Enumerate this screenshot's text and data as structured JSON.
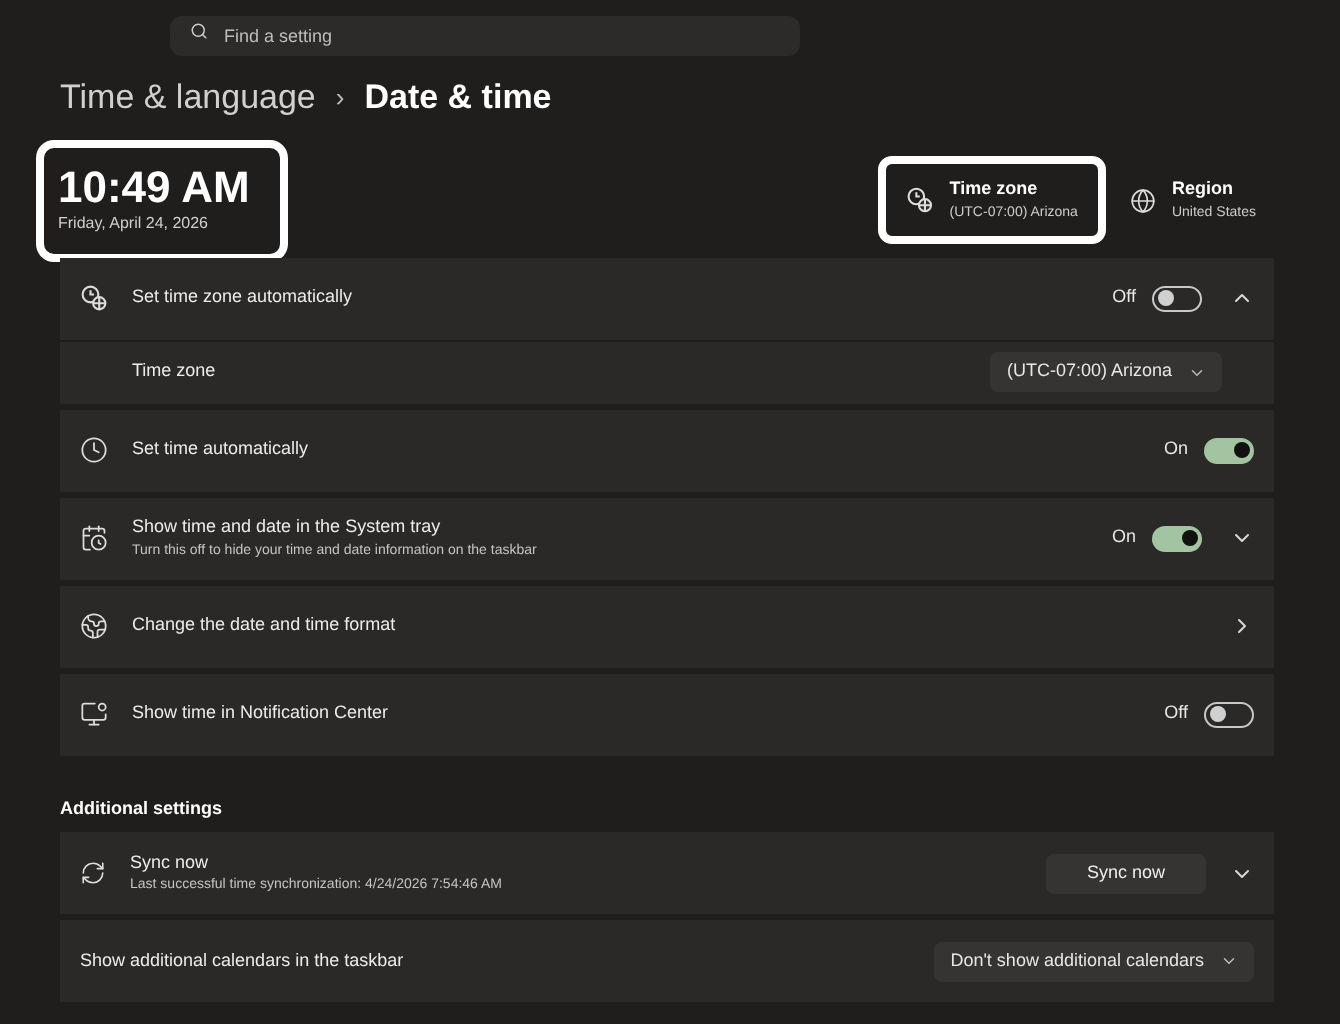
{
  "search": {
    "placeholder": "Find a setting"
  },
  "breadcrumb": {
    "parent": "Time & language",
    "separator": "›",
    "current": "Date & time"
  },
  "clock": {
    "time": "10:49 AM",
    "date": "Friday, April 24, 2026"
  },
  "summary": [
    {
      "title": "Time zone",
      "value": "(UTC-07:00) Arizona",
      "highlighted": true
    },
    {
      "title": "Region",
      "value": "United States",
      "highlighted": false
    }
  ],
  "rows": [
    {
      "kind": "toggle",
      "title": "Set time zone automatically",
      "state_text": "Off",
      "on": false,
      "expanded": true,
      "children": [
        {
          "kind": "dropdown",
          "title": "Time zone",
          "value": "(UTC-07:00) Arizona"
        }
      ]
    },
    {
      "kind": "toggle",
      "title": "Set time automatically",
      "state_text": "On",
      "on": true
    },
    {
      "kind": "toggle",
      "title": "Show time and date in the System tray",
      "subtitle": "Turn this off to hide your time and date information on the taskbar",
      "state_text": "On",
      "on": true,
      "expanded": false
    },
    {
      "kind": "link",
      "title": "Change the date and time format"
    },
    {
      "kind": "toggle",
      "title": "Show time in Notification Center",
      "state_text": "Off",
      "on": false
    }
  ],
  "additional": {
    "heading": "Additional settings",
    "rows": [
      {
        "kind": "button",
        "title": "Sync now",
        "subtitle": "Last successful time synchronization: 4/24/2026 7:54:46 AM",
        "button": "Sync now",
        "expanded": false
      },
      {
        "kind": "dropdown",
        "title": "Show additional calendars in the taskbar",
        "value": "Don't show additional calendars"
      }
    ]
  }
}
